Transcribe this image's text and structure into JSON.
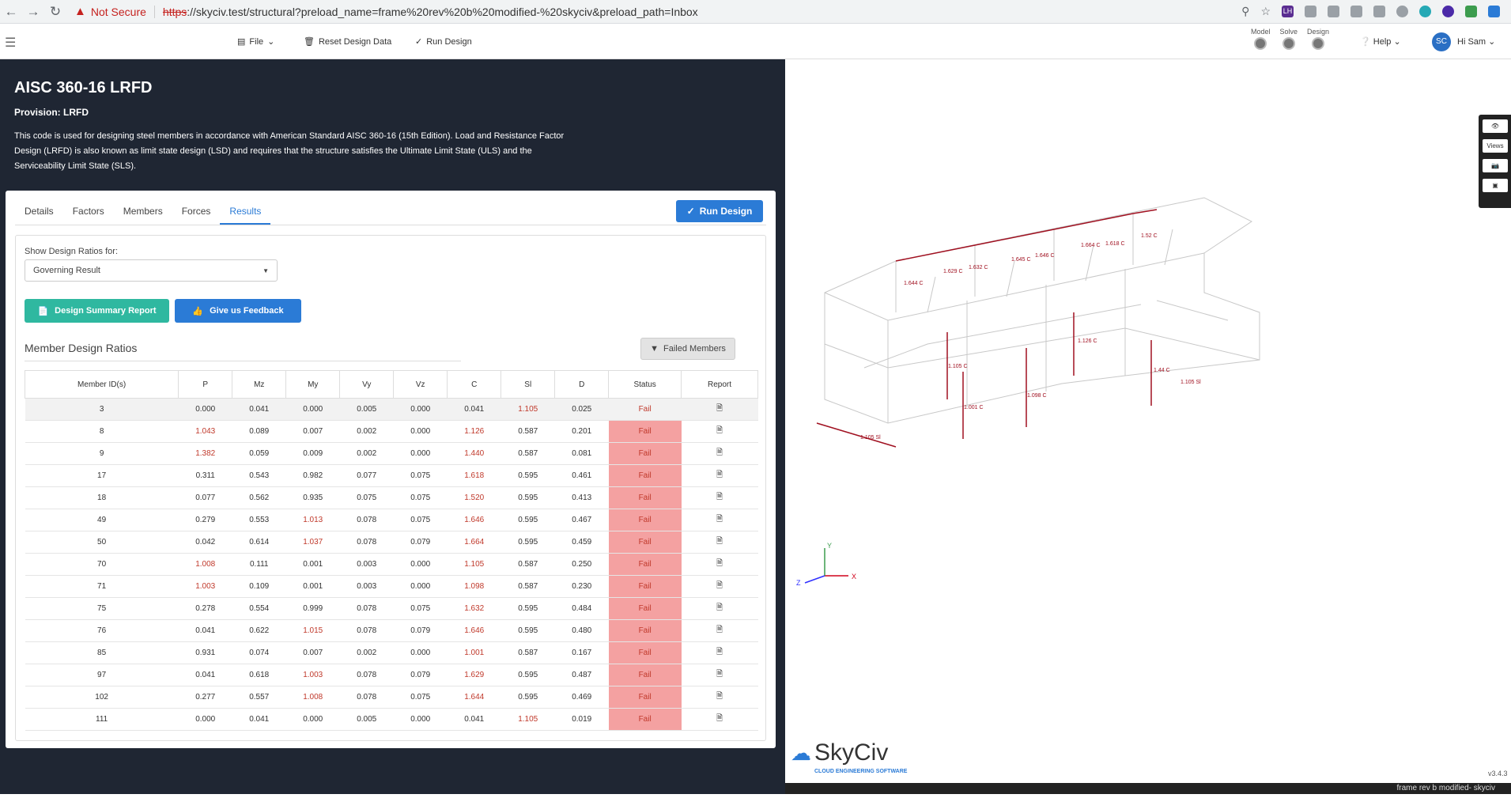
{
  "browser": {
    "not_secure": "Not Secure",
    "url_scheme": "https",
    "url_rest": "://skyciv.test/structural?preload_name=frame%20rev%20b%20modified-%20skyciv&preload_path=Inbox",
    "ext_lh": "LH"
  },
  "appbar": {
    "file": "File",
    "reset": "Reset Design Data",
    "run": "Run Design",
    "steps": [
      "Model",
      "Solve",
      "Design"
    ],
    "help": "Help",
    "avatar": "SC",
    "user": "Hi Sam"
  },
  "header": {
    "title": "AISC 360-16 LRFD",
    "provision": "Provision: LRFD",
    "description": "This code is used for designing steel members in accordance with American Standard AISC 360-16 (15th Edition). Load and Resistance Factor Design (LRFD) is also known as limit state design (LSD) and requires that the structure satisfies the Ultimate Limit State (ULS) and the Serviceability Limit State (SLS)."
  },
  "tabs": [
    "Details",
    "Factors",
    "Members",
    "Forces",
    "Results"
  ],
  "run_design": "Run Design",
  "show_label": "Show Design Ratios for:",
  "select_value": "Governing Result",
  "summary_btn": "Design Summary Report",
  "feedback_btn": "Give us Feedback",
  "section_title": "Member Design Ratios",
  "failed_btn": "Failed Members",
  "columns": [
    "Member ID(s)",
    "P",
    "Mz",
    "My",
    "Vy",
    "Vz",
    "C",
    "Sl",
    "D",
    "Status",
    "Report"
  ],
  "rows": [
    [
      "3",
      "0.000",
      "0.041",
      "0.000",
      "0.005",
      "0.000",
      "0.041",
      "1.105",
      "0.025",
      "Fail"
    ],
    [
      "8",
      "1.043",
      "0.089",
      "0.007",
      "0.002",
      "0.000",
      "1.126",
      "0.587",
      "0.201",
      "Fail"
    ],
    [
      "9",
      "1.382",
      "0.059",
      "0.009",
      "0.002",
      "0.000",
      "1.440",
      "0.587",
      "0.081",
      "Fail"
    ],
    [
      "17",
      "0.311",
      "0.543",
      "0.982",
      "0.077",
      "0.075",
      "1.618",
      "0.595",
      "0.461",
      "Fail"
    ],
    [
      "18",
      "0.077",
      "0.562",
      "0.935",
      "0.075",
      "0.075",
      "1.520",
      "0.595",
      "0.413",
      "Fail"
    ],
    [
      "49",
      "0.279",
      "0.553",
      "1.013",
      "0.078",
      "0.075",
      "1.646",
      "0.595",
      "0.467",
      "Fail"
    ],
    [
      "50",
      "0.042",
      "0.614",
      "1.037",
      "0.078",
      "0.079",
      "1.664",
      "0.595",
      "0.459",
      "Fail"
    ],
    [
      "70",
      "1.008",
      "0.111",
      "0.001",
      "0.003",
      "0.000",
      "1.105",
      "0.587",
      "0.250",
      "Fail"
    ],
    [
      "71",
      "1.003",
      "0.109",
      "0.001",
      "0.003",
      "0.000",
      "1.098",
      "0.587",
      "0.230",
      "Fail"
    ],
    [
      "75",
      "0.278",
      "0.554",
      "0.999",
      "0.078",
      "0.075",
      "1.632",
      "0.595",
      "0.484",
      "Fail"
    ],
    [
      "76",
      "0.041",
      "0.622",
      "1.015",
      "0.078",
      "0.079",
      "1.646",
      "0.595",
      "0.480",
      "Fail"
    ],
    [
      "85",
      "0.931",
      "0.074",
      "0.007",
      "0.002",
      "0.000",
      "1.001",
      "0.587",
      "0.167",
      "Fail"
    ],
    [
      "97",
      "0.041",
      "0.618",
      "1.003",
      "0.078",
      "0.079",
      "1.629",
      "0.595",
      "0.487",
      "Fail"
    ],
    [
      "102",
      "0.277",
      "0.557",
      "1.008",
      "0.078",
      "0.075",
      "1.644",
      "0.595",
      "0.469",
      "Fail"
    ],
    [
      "111",
      "0.000",
      "0.041",
      "0.000",
      "0.005",
      "0.000",
      "0.041",
      "1.105",
      "0.019",
      "Fail"
    ]
  ],
  "model_labels": [
    "1.644 C",
    "1.629 C",
    "1.632 C",
    "1.645 C",
    "1.646 C",
    "1.664 C",
    "1.618 C",
    "1.52 C",
    "1.126 C",
    "1.105 C",
    "1.098 C",
    "1.001 C",
    "1.44 C",
    "1.105 Sl",
    "1.105 Sl"
  ],
  "views_btn": "Views",
  "axes": {
    "x": "X",
    "y": "Y",
    "z": "Z"
  },
  "logo": {
    "name": "SkyCiv",
    "sub": "CLOUD ENGINEERING SOFTWARE"
  },
  "version": "v3.4.3",
  "footer": "frame rev b modified- skyciv",
  "colors": {
    "dark": "#1f2633",
    "blue": "#2b7bd6",
    "teal": "#2fb8a0",
    "fail": "#f4a1a1",
    "fail_text": "#c0392b"
  }
}
